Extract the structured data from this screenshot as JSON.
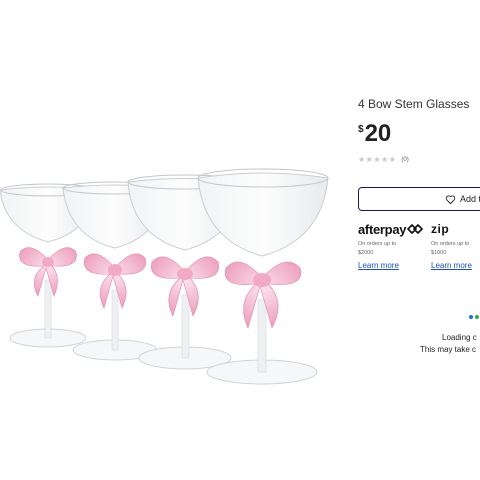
{
  "product": {
    "title": "4 Bow Stem Glasses",
    "price_currency": "$",
    "price_amount": "20",
    "rating": {
      "stars": "★★★★★",
      "count": "(0)"
    },
    "image_alt": "Four coupe glasses with pink bow stems"
  },
  "wishlist": {
    "label": "Add t",
    "icon": "heart-outline-icon"
  },
  "payment_options": [
    {
      "provider": "afterpay",
      "logo_text": "afterpay",
      "description_line1": "On orders up to",
      "description_line2": "$2000",
      "link": "Learn more"
    },
    {
      "provider": "zip",
      "logo_text": "zip",
      "description_line1": "On orders up to",
      "description_line2": "$1000",
      "link": "Learn more"
    }
  ],
  "status": {
    "line1": "Loading c",
    "line2": "This may take c"
  },
  "colors": {
    "afterpay_mint": "#b2fce4",
    "zip_purple": "#411361",
    "link": "#1e4fb3",
    "border": "#1a1a4e",
    "bow_pink": "#f4b6cc",
    "dot_blue": "#1a73e8",
    "dot_green": "#34a853"
  }
}
